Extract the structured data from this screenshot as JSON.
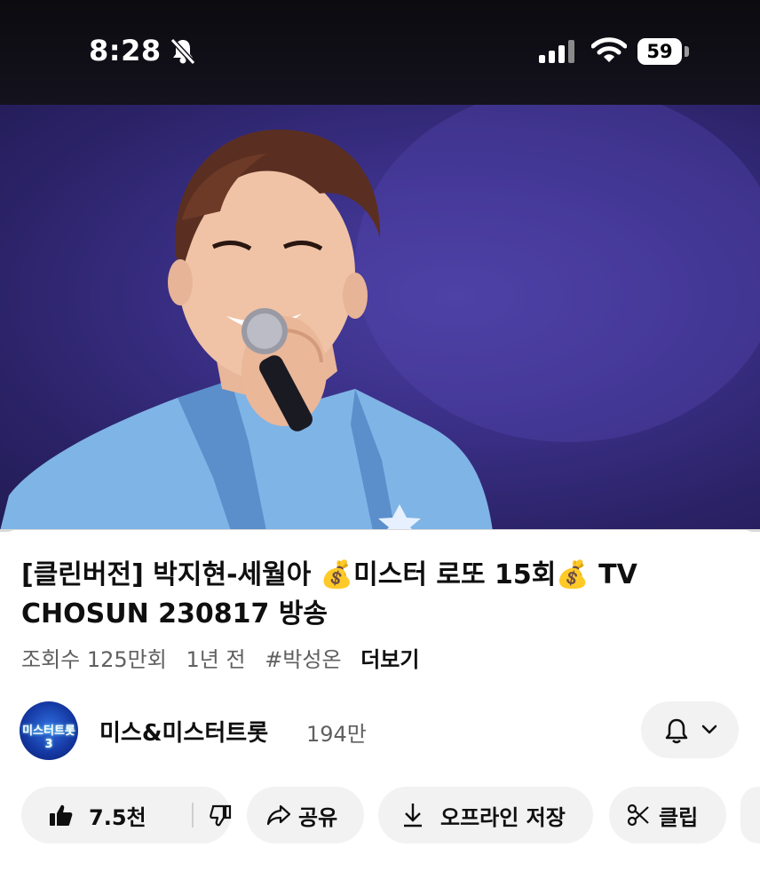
{
  "status": {
    "time": "8:28",
    "battery": "59"
  },
  "video": {
    "progress_fraction": 0.0
  },
  "title": "[클린버전] 박지현-세월아 💰미스터 로또 15회💰 TV CHOSUN 230817 방송",
  "meta": {
    "views": "조회수 125만회",
    "age": "1년 전",
    "hashtag": "#박성온",
    "more": "더보기"
  },
  "channel": {
    "avatar_text": "미스터트롯3",
    "name": "미스&미스터트롯",
    "subscribers": "194만"
  },
  "actions": {
    "like_count": "7.5천",
    "share": "공유",
    "download": "오프라인 저장",
    "clip": "클립"
  },
  "colors": {
    "accent": "#ff0033",
    "pill_bg": "#f2f2f2"
  }
}
